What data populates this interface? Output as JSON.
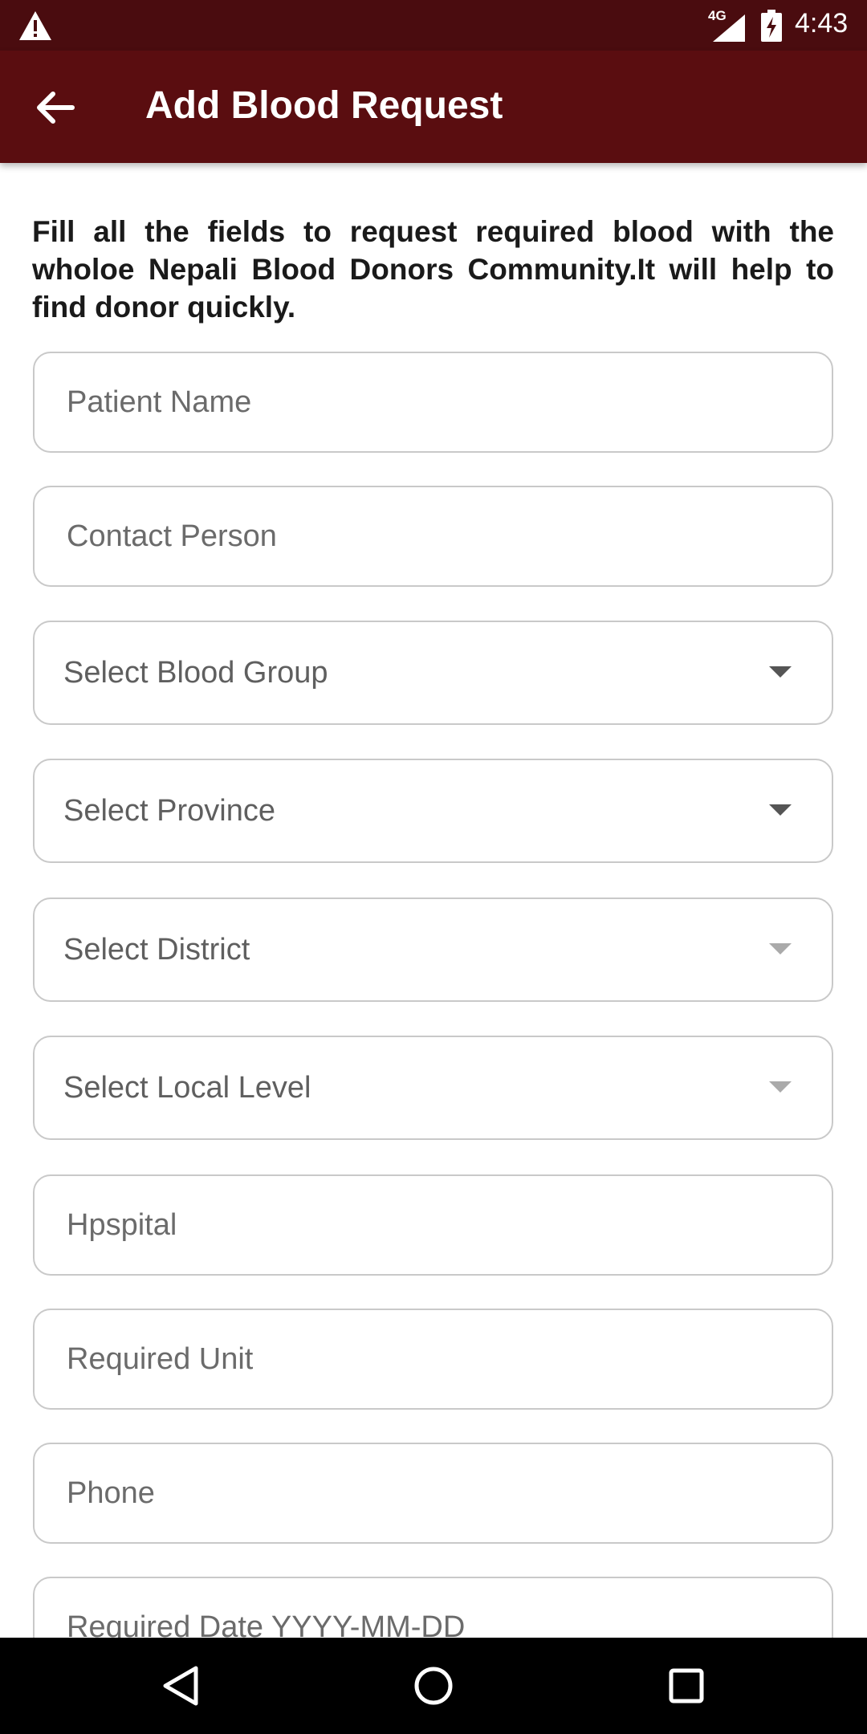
{
  "status_bar": {
    "network_label": "4G",
    "time": "4:43"
  },
  "app_bar": {
    "title": "Add Blood Request"
  },
  "intro_text": "Fill all the fields to request required blood with the wholoe Nepali Blood Donors Community.It will help to find donor quickly.",
  "form": {
    "patient_name": "Patient Name",
    "contact_person": "Contact Person",
    "blood_group": "Select Blood Group",
    "province": "Select Province",
    "district": "Select District",
    "local_level": "Select Local Level",
    "hospital": "Hpspital",
    "required_unit": "Required Unit",
    "phone": "Phone",
    "required_date": "Required Date YYYY-MM-DD"
  },
  "colors": {
    "status_bar": "#4a0c0f",
    "app_bar": "#5a0d10",
    "field_border": "#c9c9c9",
    "placeholder": "#6b6b6b"
  },
  "icons": [
    "warning-icon",
    "signal-icon",
    "battery-charging-icon",
    "back-arrow-icon",
    "dropdown-arrow-icon",
    "nav-back-icon",
    "nav-home-icon",
    "nav-recents-icon"
  ]
}
